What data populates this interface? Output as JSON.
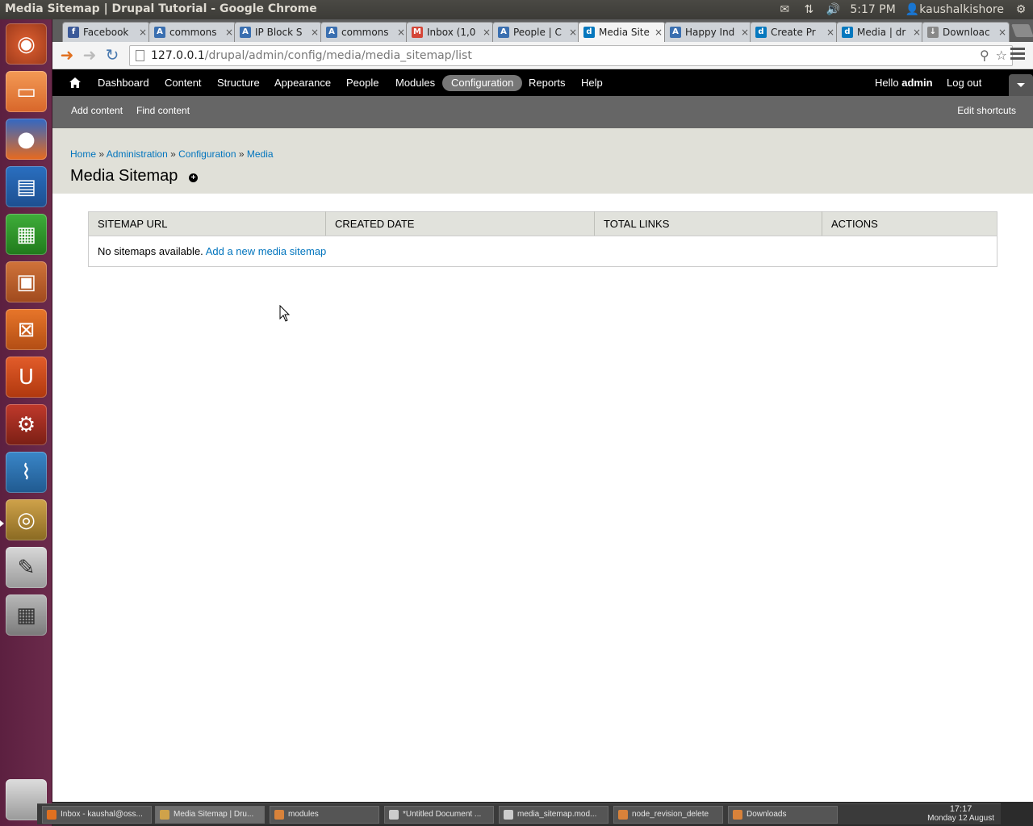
{
  "top_panel": {
    "window_title": "Media Sitemap | Drupal Tutorial - Google Chrome",
    "time": "5:17 PM",
    "user": "kaushalkishore"
  },
  "launcher": {
    "items": [
      "dash-icon",
      "files-icon",
      "firefox-icon",
      "writer-icon",
      "calc-icon",
      "impress-icon",
      "software-center-icon",
      "ubuntu-one-icon",
      "system-settings-icon",
      "system-monitor-icon",
      "chrome-icon",
      "text-editor-icon",
      "workspace-switcher-icon",
      "trash-icon"
    ]
  },
  "browser": {
    "tabs": [
      {
        "label": "Facebook",
        "icon": "facebook-icon",
        "color": "#3b5998",
        "glyph": "f"
      },
      {
        "label": "commons",
        "icon": "at-icon",
        "color": "#3a6fb0",
        "glyph": "A"
      },
      {
        "label": "IP Block S",
        "icon": "at-icon",
        "color": "#3a6fb0",
        "glyph": "A"
      },
      {
        "label": "commons",
        "icon": "at-icon",
        "color": "#3a6fb0",
        "glyph": "A"
      },
      {
        "label": "Inbox (1,0",
        "icon": "gmail-icon",
        "color": "#d44638",
        "glyph": "M"
      },
      {
        "label": "People | C",
        "icon": "at-icon",
        "color": "#3a6fb0",
        "glyph": "A"
      },
      {
        "label": "Media Site",
        "icon": "drupal-icon",
        "color": "#0678be",
        "glyph": "d"
      },
      {
        "label": "Happy Ind",
        "icon": "at-icon",
        "color": "#3a6fb0",
        "glyph": "A"
      },
      {
        "label": "Create Pr",
        "icon": "drupal-icon",
        "color": "#0678be",
        "glyph": "d"
      },
      {
        "label": "Media | dr",
        "icon": "drupal-icon",
        "color": "#0678be",
        "glyph": "d"
      },
      {
        "label": "Downloac",
        "icon": "download-icon",
        "color": "#888888",
        "glyph": "↓"
      }
    ],
    "active_tab": 6,
    "url_host": "127.0.0.1",
    "url_path": "/drupal/admin/config/media/media_sitemap/list"
  },
  "admin_menu": {
    "items": [
      "Dashboard",
      "Content",
      "Structure",
      "Appearance",
      "People",
      "Modules",
      "Configuration",
      "Reports",
      "Help"
    ],
    "active": "Configuration",
    "hello_prefix": "Hello ",
    "username": "admin",
    "logout": "Log out"
  },
  "shortcuts": {
    "items": [
      "Add content",
      "Find content"
    ],
    "edit": "Edit shortcuts"
  },
  "breadcrumb": {
    "items": [
      "Home",
      "Administration",
      "Configuration",
      "Media"
    ],
    "separator": "»"
  },
  "page_title": "Media Sitemap",
  "table": {
    "columns": [
      "Sitemap URL",
      "Created Date",
      "Total Links",
      "Actions"
    ],
    "empty_text": "No sitemaps available.",
    "empty_link": "Add a new media sitemap"
  },
  "taskbar": {
    "tasks": [
      "Inbox - kaushal@oss...",
      "Media Sitemap | Dru...",
      "modules",
      "*Untitled Document ...",
      "media_sitemap.mod...",
      "node_revision_delete",
      "Downloads"
    ],
    "clock_time": "17:17",
    "clock_date": "Monday 12 August"
  }
}
